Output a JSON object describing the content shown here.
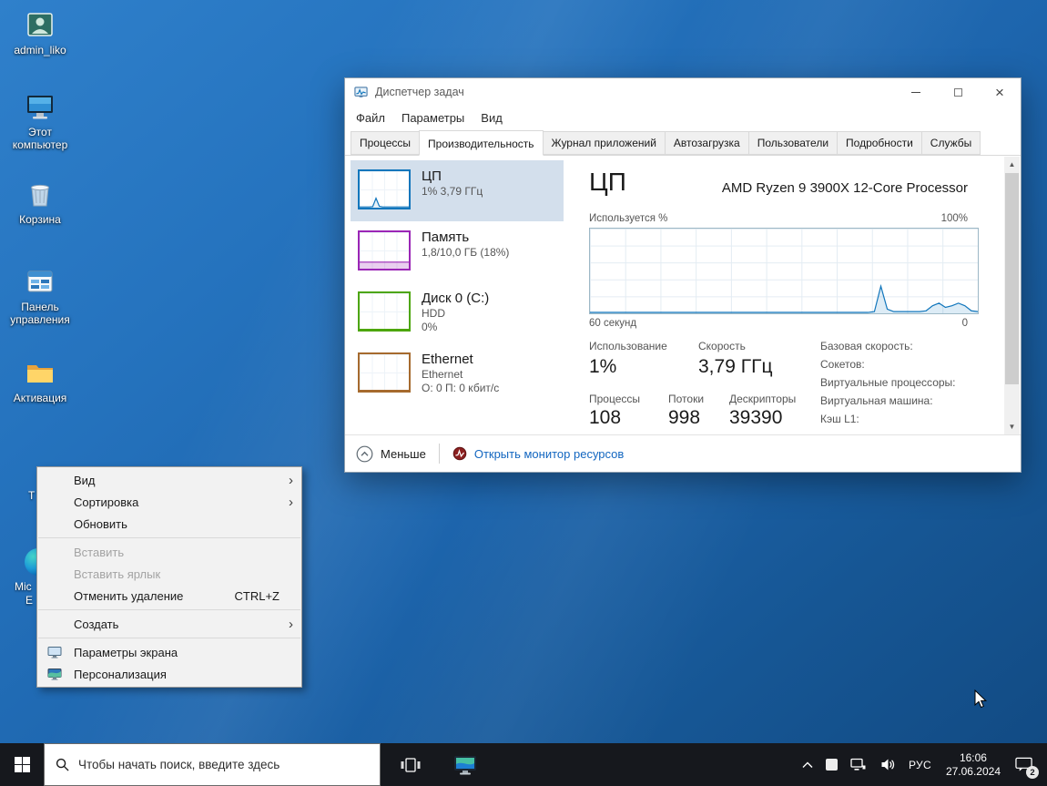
{
  "desktop": {
    "icons": [
      {
        "label": "admin_liko"
      },
      {
        "label": "Этот компьютер"
      },
      {
        "label": "Корзина"
      },
      {
        "label": "Панель управления"
      },
      {
        "label": "Активация"
      }
    ],
    "partial": {
      "t_fragment": "Т",
      "edge_line1": "Mic",
      "edge_line2": "Е"
    }
  },
  "context_menu": {
    "items": [
      {
        "label": "Вид"
      },
      {
        "label": "Сортировка"
      },
      {
        "label": "Обновить"
      },
      {
        "label": "Вставить"
      },
      {
        "label": "Вставить ярлык"
      },
      {
        "label": "Отменить удаление",
        "shortcut": "CTRL+Z"
      },
      {
        "label": "Создать"
      },
      {
        "label": "Параметры экрана"
      },
      {
        "label": "Персонализация"
      }
    ]
  },
  "task_manager": {
    "title": "Диспетчер задач",
    "menu": [
      "Файл",
      "Параметры",
      "Вид"
    ],
    "tabs": [
      "Процессы",
      "Производительность",
      "Журнал приложений",
      "Автозагрузка",
      "Пользователи",
      "Подробности",
      "Службы"
    ],
    "active_tab": "Производительность",
    "sidebar": [
      {
        "title": "ЦП",
        "line1": "1% 3,79 ГГц",
        "color": "#1176bc",
        "fill": "rgba(17,118,188,0.10)",
        "points": [
          2,
          2,
          2,
          2,
          3,
          26,
          4,
          2,
          2,
          2,
          2,
          2,
          2,
          2,
          2,
          2
        ]
      },
      {
        "title": "Память",
        "line1": "1,8/10,0 ГБ (18%)",
        "color": "#9b26b6",
        "fill": "rgba(155,38,182,0.22)",
        "points": [
          18,
          18,
          18,
          18,
          18,
          18,
          18,
          18,
          18,
          18,
          18,
          18,
          18,
          18,
          18,
          18
        ]
      },
      {
        "title": "Диск 0 (C:)",
        "line1": "HDD",
        "line2": "0%",
        "color": "#4da60c",
        "fill": "rgba(77,166,12,0.10)",
        "points": [
          1,
          1,
          1,
          1,
          1,
          1,
          1,
          1,
          1,
          1,
          1,
          1,
          1,
          1,
          1,
          1
        ]
      },
      {
        "title": "Ethernet",
        "line1": "Ethernet",
        "line2": "О: 0 П: 0 кбит/с",
        "color": "#a66a2e",
        "fill": "rgba(166,106,46,0.10)",
        "points": [
          1,
          1,
          1,
          1,
          1,
          1,
          1,
          1,
          1,
          1,
          1,
          1,
          1,
          1,
          1,
          1
        ]
      }
    ],
    "cpu_pane": {
      "heading": "ЦП",
      "cpu_name": "AMD Ryzen 9 3900X 12-Core Processor",
      "used_label": "Используется %",
      "scale_max": "100%",
      "x_left": "60 секунд",
      "x_right": "0",
      "stats": {
        "usage_label": "Использование",
        "usage_value": "1%",
        "speed_label": "Скорость",
        "speed_value": "3,79 ГГц",
        "processes_label": "Процессы",
        "processes_value": "108",
        "threads_label": "Потоки",
        "threads_value": "998",
        "handles_label": "Дескрипторы",
        "handles_value": "39390"
      },
      "info_labels": [
        "Базовая скорость:",
        "Сокетов:",
        "Виртуальные процессоры:",
        "Виртуальная машина:",
        "Кэш L1:"
      ]
    },
    "footer": {
      "fewer_label": "Меньше",
      "resmon_label": "Открыть монитор ресурсов",
      "link_color": "#1266c0"
    }
  },
  "chart_data": {
    "type": "line",
    "title": "ЦП — Используется %",
    "ylim": [
      0,
      100
    ],
    "x_axis": "секунды (60 → 0)",
    "color": "#1176bc",
    "fill": "rgba(17,118,188,0.14)",
    "points": [
      1,
      1,
      1,
      1,
      1,
      1,
      1,
      1,
      1,
      1,
      1,
      1,
      1,
      1,
      1,
      1,
      1,
      1,
      1,
      1,
      1,
      1,
      1,
      1,
      1,
      1,
      1,
      1,
      1,
      1,
      1,
      1,
      1,
      1,
      1,
      1,
      1,
      1,
      1,
      1,
      1,
      1,
      1,
      1,
      2,
      32,
      5,
      2,
      2,
      2,
      2,
      2,
      3,
      9,
      12,
      7,
      9,
      12,
      9,
      3,
      2
    ]
  },
  "taskbar": {
    "search_placeholder": "Чтобы начать поиск, введите здесь",
    "tray": {
      "lang": "РУС",
      "time": "16:06",
      "date": "27.06.2024",
      "badge": "2"
    }
  }
}
